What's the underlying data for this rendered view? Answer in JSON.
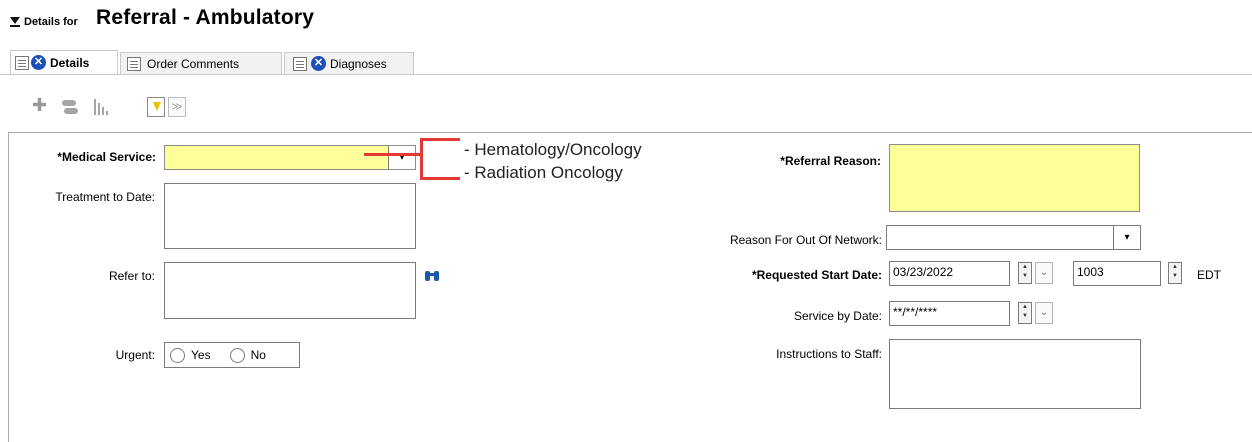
{
  "header": {
    "details_for": "Details for",
    "title": "Referral - Ambulatory"
  },
  "tabs": [
    {
      "label": "Details"
    },
    {
      "label": "Order Comments"
    },
    {
      "label": "Diagnoses"
    }
  ],
  "toolbar": {
    "add_icon": "plus-icon",
    "pill_icon": "pill-icon",
    "chart_icon": "bar-chart-icon",
    "next_required_icon": "yellow-down-arrow-icon",
    "next_icon": "double-chevron-down-icon"
  },
  "form": {
    "medical_service": {
      "label": "*Medical Service:",
      "value": ""
    },
    "treatment_to_date": {
      "label": "Treatment to Date:",
      "value": ""
    },
    "refer_to": {
      "label": "Refer to:",
      "value": ""
    },
    "urgent": {
      "label": "Urgent:",
      "options": [
        "Yes",
        "No"
      ]
    },
    "referral_reason": {
      "label": "*Referral Reason:",
      "value": ""
    },
    "reason_out_of_network": {
      "label": "Reason For Out Of Network:",
      "value": ""
    },
    "requested_start_date": {
      "label": "*Requested Start Date:",
      "date": "03/23/2022",
      "time": "1003",
      "tz": "EDT"
    },
    "service_by_date": {
      "label": "Service by Date:",
      "value": "**/**/****"
    },
    "instructions_to_staff": {
      "label": "Instructions to Staff:",
      "value": ""
    }
  },
  "annotation": {
    "options": [
      "- Hematology/Oncology",
      "- Radiation Oncology"
    ],
    "color": "#e53935"
  },
  "colors": {
    "required_field": "#ffff99",
    "tab_x_icon": "#1d4fb8"
  }
}
